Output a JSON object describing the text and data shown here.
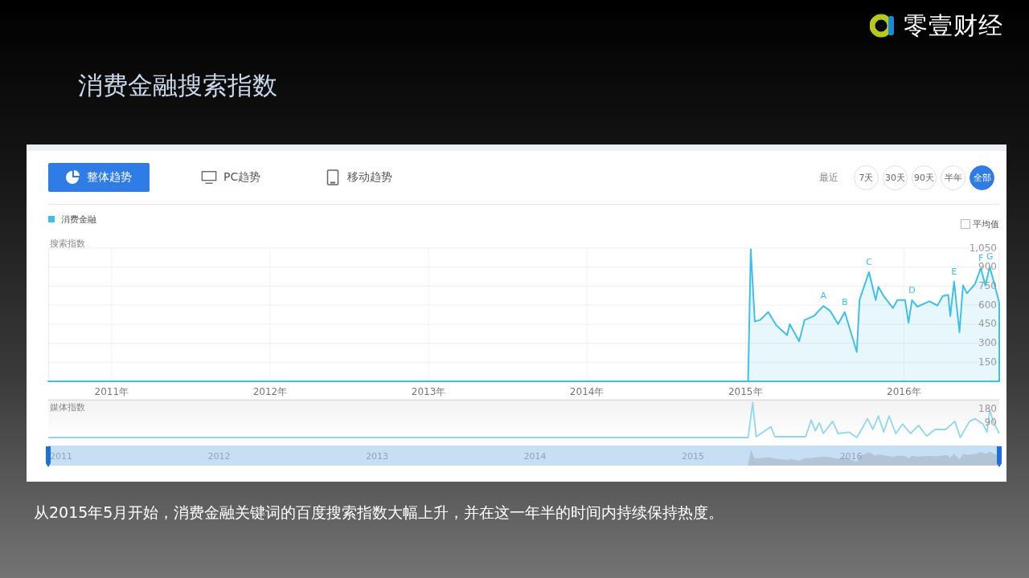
{
  "logo": {
    "text": "零壹财经"
  },
  "title": "消费金融搜索指数",
  "panel": {
    "tabs": [
      {
        "label": "整体趋势",
        "selected": true
      },
      {
        "label": "PC趋势",
        "selected": false
      },
      {
        "label": "移动趋势",
        "selected": false
      }
    ],
    "range_label": "最近",
    "ranges": [
      {
        "label": "7天",
        "selected": false
      },
      {
        "label": "30天",
        "selected": false
      },
      {
        "label": "90天",
        "selected": false
      },
      {
        "label": "半年",
        "selected": false
      },
      {
        "label": "全部",
        "selected": true
      }
    ],
    "average": {
      "label": "平均值",
      "checked": false
    },
    "search_chart": {
      "chart_data": {
        "type": "area",
        "ylabel": "搜索指数",
        "grid": true,
        "xlim": [
          2010.6,
          2016.602
        ],
        "ylim": [
          0,
          1050
        ],
        "yticks": [
          150,
          300,
          450,
          600,
          750,
          900,
          {
            "value": 1050,
            "label": "1,050"
          }
        ],
        "xticks": [
          {
            "value": 2011,
            "label": "2011年"
          },
          {
            "value": 2012,
            "label": "2012年"
          },
          {
            "value": 2013,
            "label": "2013年"
          },
          {
            "value": 2014,
            "label": "2014年"
          },
          {
            "value": 2015,
            "label": "2015年"
          },
          {
            "value": 2016,
            "label": "2016年"
          }
        ],
        "x": [
          2010.6,
          2015.017,
          2015.034,
          2015.059,
          2015.093,
          2015.144,
          2015.195,
          2015.263,
          2015.28,
          2015.339,
          2015.373,
          2015.432,
          2015.492,
          2015.534,
          2015.585,
          2015.627,
          2015.703,
          2015.72,
          2015.78,
          2015.822,
          2015.839,
          2015.873,
          2015.932,
          2015.958,
          2016.008,
          2016.029,
          2016.051,
          2016.085,
          2016.161,
          2016.212,
          2016.246,
          2016.28,
          2016.293,
          2016.317,
          2016.351,
          2016.373,
          2016.398,
          2016.449,
          2016.486,
          2016.514,
          2016.542,
          2016.602
        ],
        "series": [
          {
            "name": "消费金融",
            "color": "#3ec0e8",
            "values": [
              0,
              0,
              1040,
              472,
              483,
              546,
              441,
              363,
              451,
              315,
              483,
              514,
              594,
              556,
              451,
              546,
              231,
              640,
              861,
              640,
              745,
              672,
              577,
              640,
              640,
              462,
              640,
              588,
              630,
              598,
              672,
              682,
              514,
              787,
              388,
              756,
              693,
              766,
              892,
              756,
              903,
              619
            ]
          }
        ],
        "annotations": [
          "A",
          "B",
          "C",
          "D",
          "E",
          "F",
          "G"
        ]
      }
    },
    "media_chart": {
      "chart_data": {
        "type": "line",
        "ylabel": "媒体指数",
        "xlim": [
          2010.6,
          2016.602
        ],
        "ylim": [
          0,
          240
        ],
        "yticks": [
          90,
          180
        ],
        "x": [
          2010.6,
          2015.017,
          2015.046,
          2015.068,
          2015.161,
          2015.186,
          2015.381,
          2015.415,
          2015.441,
          2015.466,
          2015.492,
          2015.551,
          2015.585,
          2015.653,
          2015.703,
          2015.771,
          2015.805,
          2015.839,
          2015.873,
          2015.907,
          2015.949,
          2015.992,
          2016.042,
          2016.093,
          2016.144,
          2016.195,
          2016.263,
          2016.322,
          2016.356,
          2016.415,
          2016.449,
          2016.5,
          2016.525,
          2016.542,
          2016.568,
          2016.602
        ],
        "series": [
          {
            "color": "#8ed8ee",
            "values": [
              0,
              0,
              227,
              5,
              70,
              5,
              5,
              114,
              44,
              96,
              26,
              105,
              26,
              35,
              0,
              122,
              52,
              140,
              35,
              140,
              26,
              87,
              26,
              79,
              9,
              52,
              52,
              105,
              0,
              105,
              122,
              87,
              35,
              175,
              96,
              26
            ]
          }
        ]
      }
    },
    "navigator": {
      "labels": [
        "2011",
        "2012",
        "2013",
        "2014",
        "2015",
        "2016"
      ]
    }
  },
  "caption": "从2015年5月开始，消费金融关键词的百度搜索指数大幅上升，并在这一年半的时间内持续保持热度。"
}
